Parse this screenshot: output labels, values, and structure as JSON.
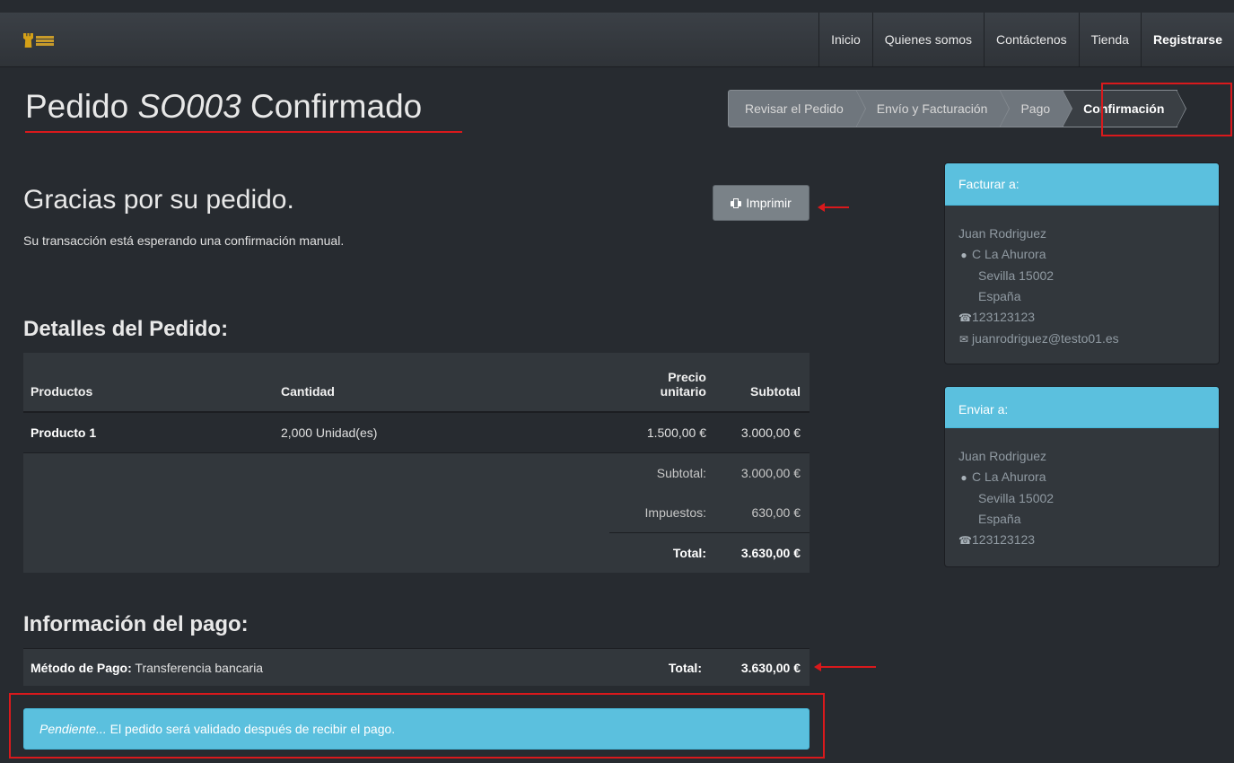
{
  "nav": {
    "items": [
      "Inicio",
      "Quienes somos",
      "Contáctenos",
      "Tienda"
    ],
    "register": "Registrarse"
  },
  "page": {
    "title_prefix": "Pedido",
    "order_number": "SO003",
    "title_suffix": "Confirmado"
  },
  "wizard": {
    "steps": [
      "Revisar el Pedido",
      "Envío y Facturación",
      "Pago",
      "Confirmación"
    ],
    "active": "Confirmación"
  },
  "thanks": {
    "heading": "Gracias por su pedido.",
    "status": "Su transacción está esperando una confirmación manual.",
    "print_label": "Imprimir"
  },
  "order": {
    "heading": "Detalles del Pedido:",
    "columns": {
      "products": "Productos",
      "quantity": "Cantidad",
      "unit_price_1": "Precio",
      "unit_price_2": "unitario",
      "subtotal": "Subtotal"
    },
    "rows": [
      {
        "product": "Producto 1",
        "quantity": "2,000 Unidad(es)",
        "unit_price": "1.500,00 €",
        "subtotal": "3.000,00 €"
      }
    ],
    "subtotal_label": "Subtotal:",
    "subtotal": "3.000,00 €",
    "taxes_label": "Impuestos:",
    "taxes": "630,00 €",
    "total_label": "Total:",
    "total": "3.630,00 €"
  },
  "payment": {
    "heading": "Información del pago:",
    "method_label": "Método de Pago:",
    "method": "Transferencia bancaria",
    "total_label": "Total:",
    "total": "3.630,00 €",
    "alert_em": "Pendiente...",
    "alert_text": " El pedido será validado después de recibir el pago."
  },
  "billing": {
    "header": "Facturar a:",
    "name": "Juan Rodriguez",
    "street": "C La Ahurora",
    "city": "Sevilla 15002",
    "country": "España",
    "phone": "123123123",
    "email": "juanrodriguez@testo01.es"
  },
  "shipping": {
    "header": "Enviar a:",
    "name": "Juan Rodriguez",
    "street": "C La Ahurora",
    "city": "Sevilla 15002",
    "country": "España",
    "phone": "123123123"
  },
  "colors": {
    "background": "#272b30",
    "panel": "#32373c",
    "info": "#5bc0de",
    "annotation_red": "#d9191c"
  }
}
